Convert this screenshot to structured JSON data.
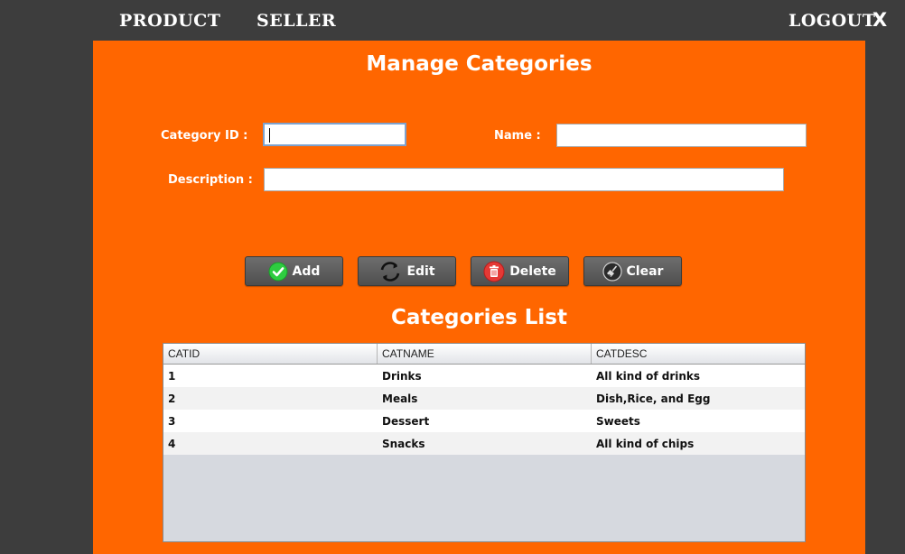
{
  "nav": {
    "product": "PRODUCT",
    "seller": "SELLER",
    "logout": "LOGOUT",
    "close": "X"
  },
  "form": {
    "title": "Manage Categories",
    "category_id_label": "Category ID :",
    "category_id_value": "",
    "name_label": "Name :",
    "name_value": "",
    "description_label": "Description :",
    "description_value": ""
  },
  "buttons": {
    "add": "Add",
    "edit": "Edit",
    "delete": "Delete",
    "clear": "Clear"
  },
  "list": {
    "title": "Categories List",
    "columns": [
      "CATID",
      "CATNAME",
      "CATDESC"
    ],
    "rows": [
      [
        "1",
        "Drinks",
        "All kind of drinks"
      ],
      [
        "2",
        "Meals",
        "Dish,Rice, and Egg"
      ],
      [
        "3",
        "Dessert",
        "Sweets"
      ],
      [
        "4",
        "Snacks",
        "All kind of chips"
      ]
    ]
  },
  "colors": {
    "panel": "#ff6600",
    "background": "#3d3d3d",
    "add_icon": "#2ecc40",
    "delete_icon": "#e53935"
  },
  "icons": {
    "add": "check-circle-icon",
    "edit": "refresh-icon",
    "delete": "trash-icon",
    "clear": "broom-icon"
  }
}
